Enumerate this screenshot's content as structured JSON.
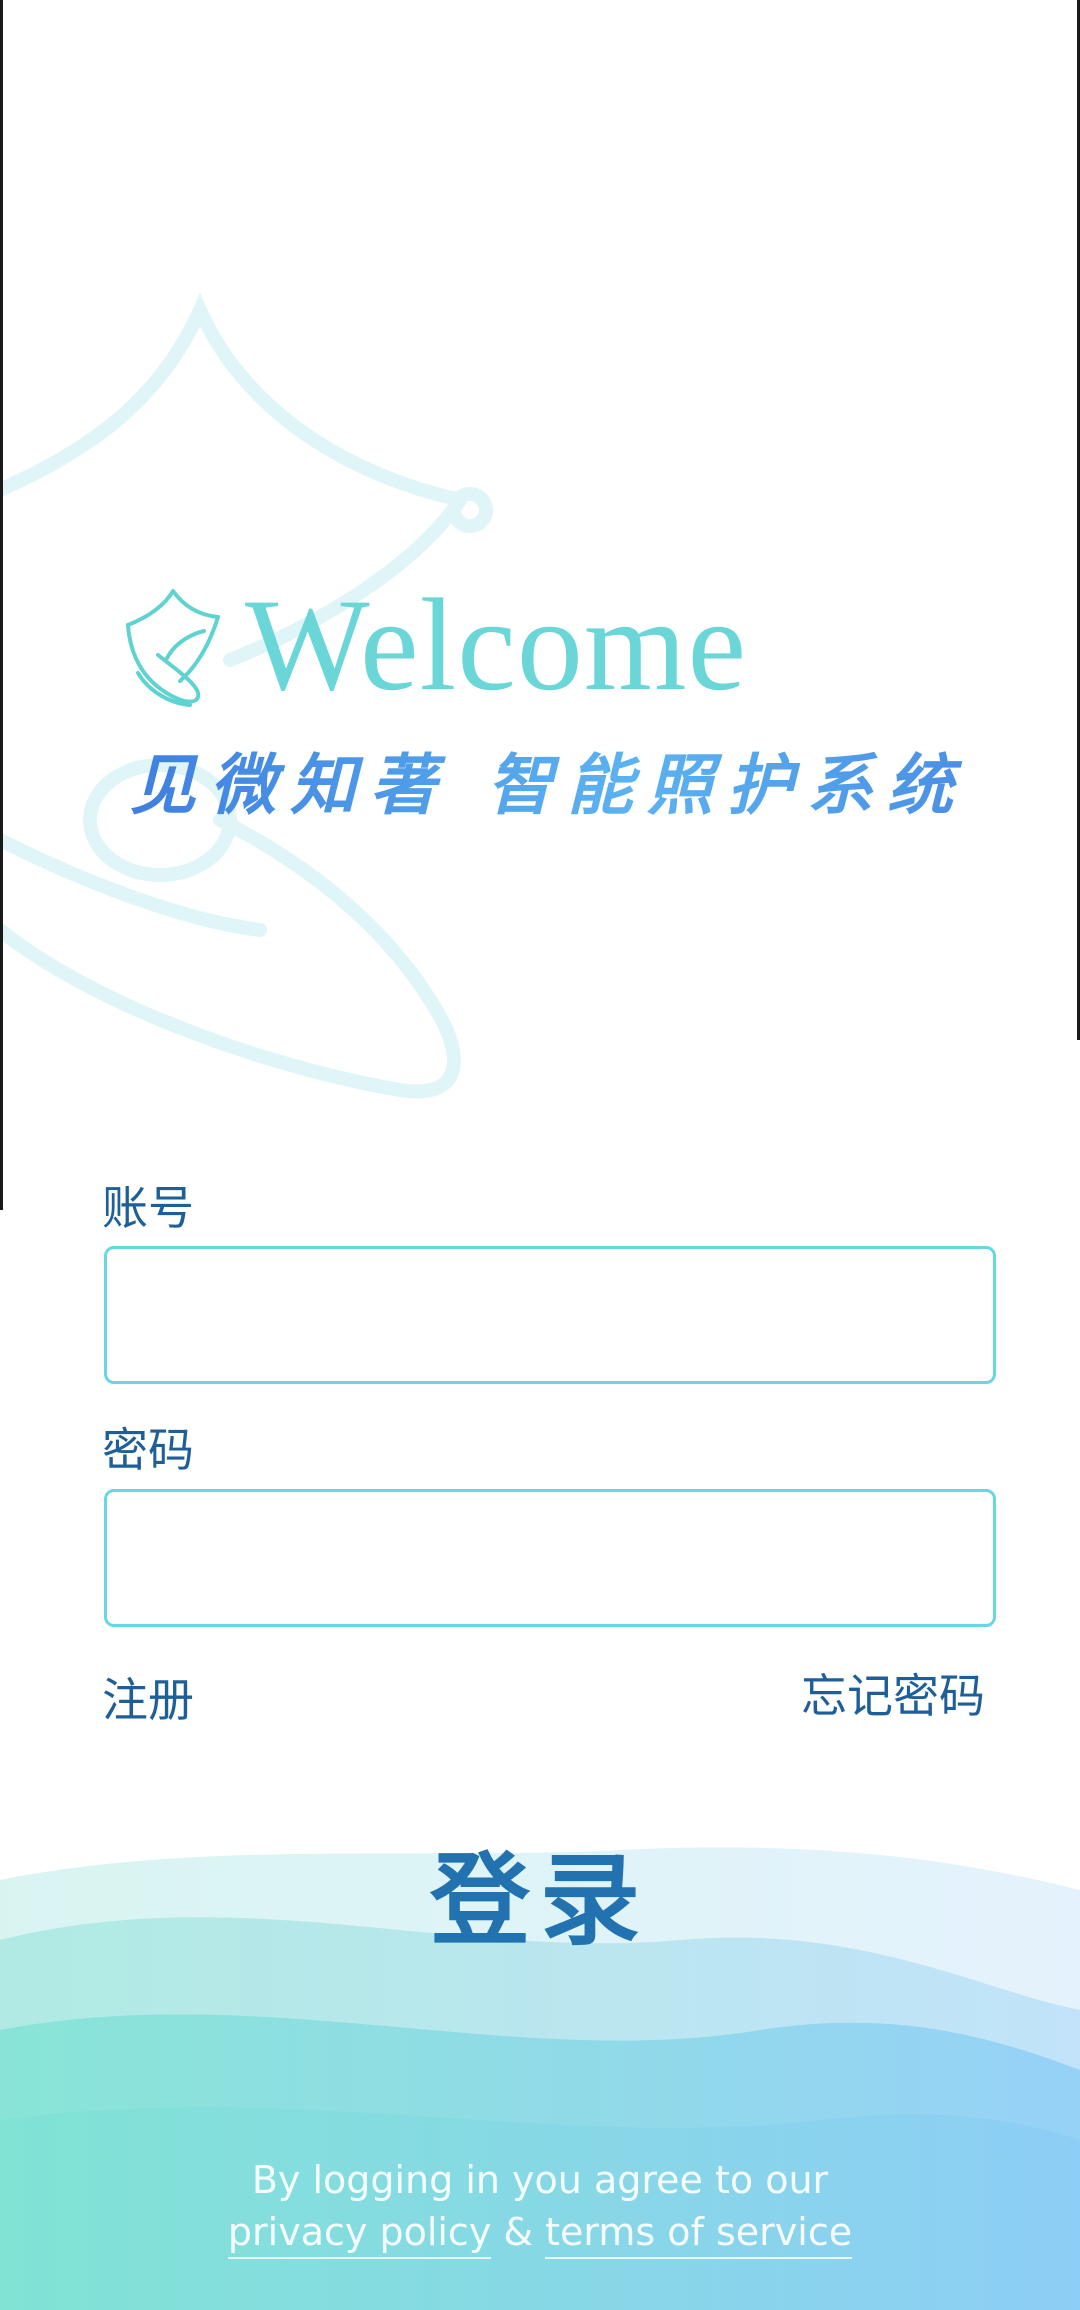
{
  "brand": {
    "welcome": "Welcome",
    "slogan": "见微知著 智能照护系统",
    "logo_icon": "shield-leaf-icon"
  },
  "form": {
    "account_label": "账号",
    "account_value": "",
    "password_label": "密码",
    "password_value": ""
  },
  "links": {
    "register": "注册",
    "forgot_password": "忘记密码"
  },
  "login_button": "登录",
  "footer": {
    "agree_text": "By logging in you agree to our",
    "privacy_policy": "privacy policy",
    "ampersand": "&",
    "terms_of_service": "terms of service"
  },
  "colors": {
    "accent_teal": "#67d7e0",
    "label_blue": "#1e5f99",
    "slogan_blue": "#3f7fe0",
    "wave_teal": "#7fe3d8",
    "wave_blue": "#8fcff5"
  }
}
